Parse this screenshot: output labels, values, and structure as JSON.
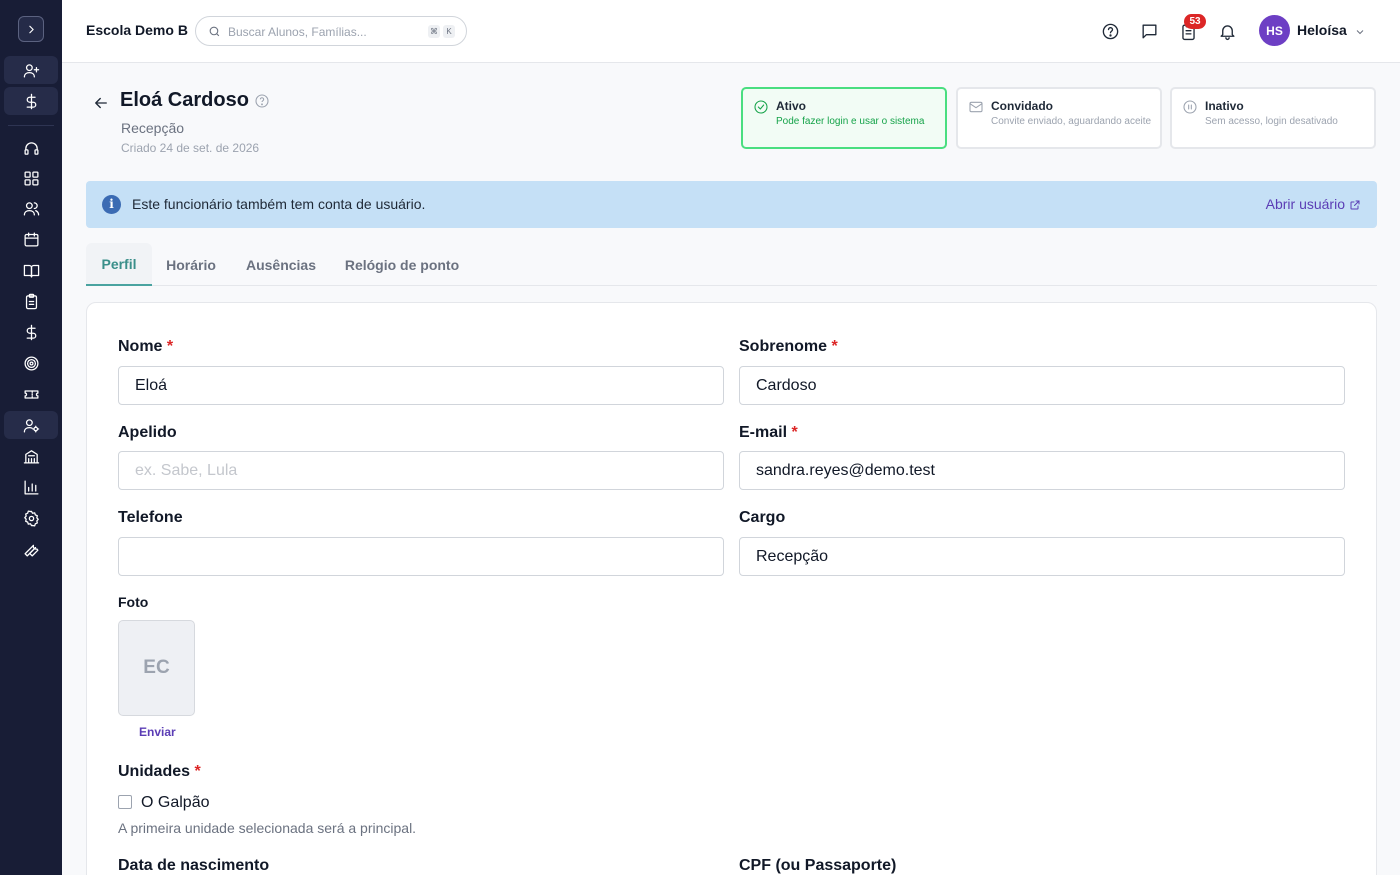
{
  "topbar": {
    "school_name": "Escola Demo B",
    "search_placeholder": "Buscar Alunos, Famílias...",
    "kbd_cmd": "⌘",
    "kbd_k": "K",
    "notification_count": "53",
    "user_initials": "HS",
    "user_name": "Heloísa"
  },
  "sidebar": {
    "icons": [
      "chevron-right-icon",
      "user-plus-icon",
      "dollar-icon",
      "headset-icon",
      "grid-icon",
      "users-icon",
      "calendar-icon",
      "book-icon",
      "clipboard-icon",
      "dollar-icon",
      "target-icon",
      "ticket-icon",
      "user-cog-icon",
      "building-icon",
      "bar-chart-icon",
      "gear-icon",
      "wrench-icon"
    ],
    "active": "user-cog-icon"
  },
  "employee": {
    "name": "Eloá Cardoso",
    "role": "Recepção",
    "created": "Criado 24 de set. de 2026"
  },
  "statuses": [
    {
      "title": "Ativo",
      "desc": "Pode fazer login e usar o sistema",
      "selected": true,
      "color": "#4ade80"
    },
    {
      "title": "Convidado",
      "desc": "Convite enviado, aguardando aceite",
      "selected": false
    },
    {
      "title": "Inativo",
      "desc": "Sem acesso, login desativado",
      "selected": false
    }
  ],
  "banner": {
    "text": "Este funcionário também tem conta de usuário.",
    "link": "Abrir usuário"
  },
  "tabs": [
    "Perfil",
    "Horário",
    "Ausências",
    "Relógio de ponto"
  ],
  "form": {
    "first_name": {
      "label": "Nome",
      "value": "Eloá"
    },
    "last_name": {
      "label": "Sobrenome",
      "value": "Cardoso"
    },
    "nickname": {
      "label": "Apelido",
      "value": "",
      "placeholder": "ex. Sabe, Lula"
    },
    "email": {
      "label": "E-mail",
      "value": "sandra.reyes@demo.test"
    },
    "phone": {
      "label": "Telefone",
      "value": ""
    },
    "position": {
      "label": "Cargo",
      "value": "Recepção"
    },
    "photo": {
      "label": "Foto",
      "initials": "EC",
      "upload": "Enviar"
    },
    "units": {
      "label": "Unidades",
      "option": "O Galpão",
      "hint": "A primeira unidade selecionada será a principal."
    },
    "birth_date": {
      "label": "Data de nascimento"
    },
    "cpf": {
      "label": "CPF (ou Passaporte)"
    },
    "required_mark": "*"
  },
  "colors": {
    "sidebar": "#181d36",
    "accent": "#3a8f8a",
    "link": "#5b3db5",
    "banner": "#c5e0f6",
    "badge": "#dc2626"
  }
}
